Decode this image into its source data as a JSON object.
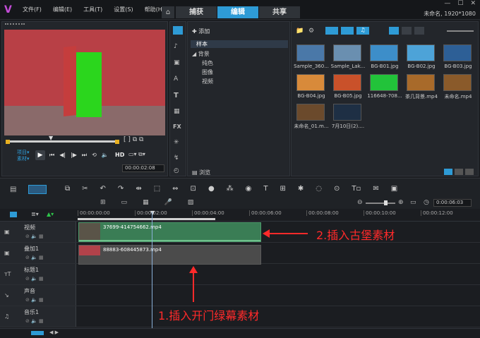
{
  "app": {
    "title": "未命名, 1920*1080",
    "logo": "V"
  },
  "menu": [
    "文件(F)",
    "编辑(E)",
    "工具(T)",
    "设置(S)",
    "帮助(H)"
  ],
  "tabs": {
    "home": "⌂",
    "capture": "捕获",
    "edit": "编辑",
    "share": "共享"
  },
  "library": {
    "add_label": "添加",
    "tree": [
      "样本",
      "背景",
      "纯色",
      "图像",
      "视频"
    ],
    "browse_label": "浏览",
    "items": [
      {
        "label": "Sample_360...",
        "bg": "#4a78a8"
      },
      {
        "label": "Sample_Lak...",
        "bg": "#6a8fb0"
      },
      {
        "label": "BG-B01.jpg",
        "bg": "#3d8ec9"
      },
      {
        "label": "BG-B02.jpg",
        "bg": "#4da3d8"
      },
      {
        "label": "BG-B03.jpg",
        "bg": "#2d5f96"
      },
      {
        "label": "BG-B04.jpg",
        "bg": "#d88a3a"
      },
      {
        "label": "BG-B05.jpg",
        "bg": "#c9512a"
      },
      {
        "label": "116648-708...",
        "bg": "#22c33a"
      },
      {
        "label": "茶几背景.mp4",
        "bg": "#a86a2a"
      },
      {
        "label": "未命名.mp4",
        "bg": "#8a5a2a"
      },
      {
        "label": "未命名_01.m...",
        "bg": "#6b4a2c"
      },
      {
        "label": "7月10日(2)....",
        "bg": "#1e2f44"
      }
    ]
  },
  "player": {
    "mode1": "项目▾",
    "mode2": "素材▾",
    "hd": "HD",
    "timecode": "00:00:02:08"
  },
  "timeline": {
    "ruler": [
      "00:00:00:00",
      "00:00:02:00",
      "00:00:04:00",
      "00:00:06:00",
      "00:00:08:00",
      "00:00:10:00",
      "00:00:12:00"
    ],
    "duration": "0:00:06:03",
    "tracks": [
      {
        "name": "视频"
      },
      {
        "name": "叠加1"
      },
      {
        "name": "标题1"
      },
      {
        "name": "声音"
      },
      {
        "name": "音乐1"
      }
    ],
    "clip1": "37699-414754662.mp4",
    "clip2": "88883-608445873.mp4"
  },
  "annotations": {
    "a1": "2.插入古堡素材",
    "a2": "1.插入开门绿幕素材"
  },
  "colors": {
    "accent": "#2e9bd6",
    "annotation": "#ff2a2a",
    "clip_green": "#3a7d55",
    "clip_gray": "#4b4b4b"
  }
}
